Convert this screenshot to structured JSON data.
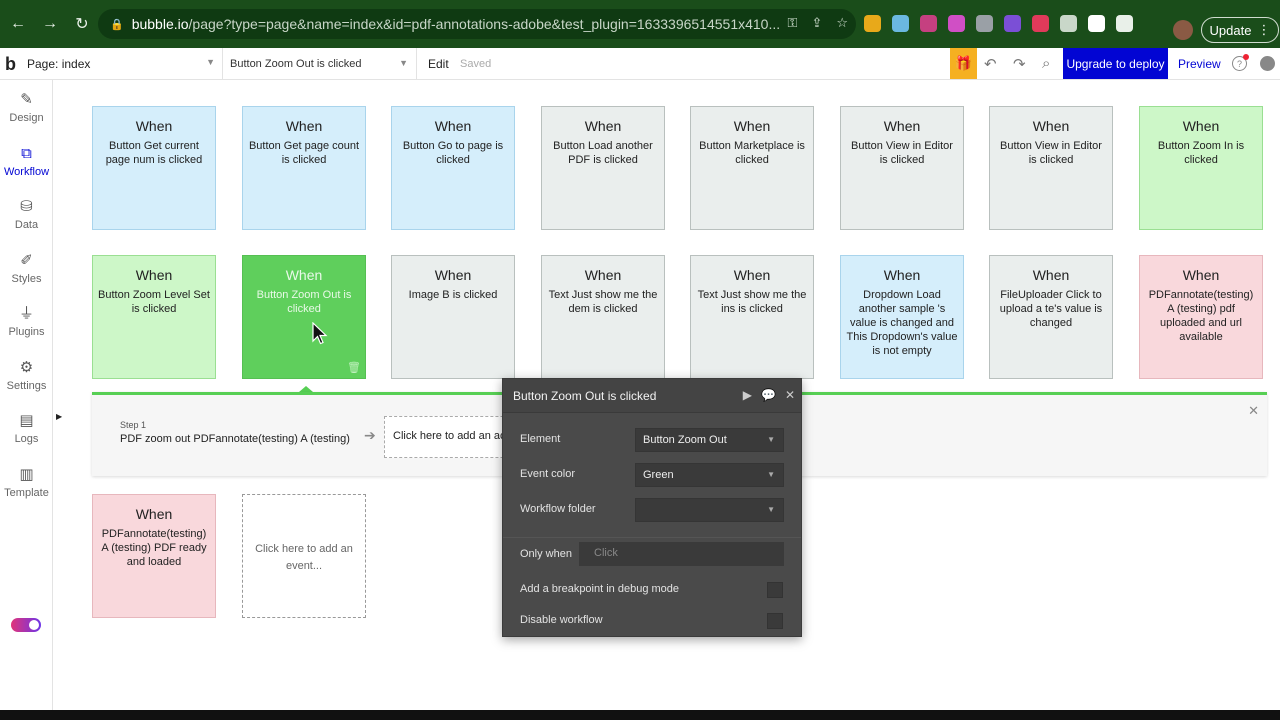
{
  "browser": {
    "url_host": "bubble.io",
    "url_path": "/page?type=page&name=index&id=pdf-annotations-adobe&test_plugin=1633396514551x410...",
    "update_label": "Update",
    "nav": [
      "back-icon",
      "forward-icon",
      "reload-icon"
    ]
  },
  "topbar": {
    "page_label": "Page: index",
    "event_label": "Button Zoom Out is clicked",
    "edit_label": "Edit",
    "saved_label": "Saved",
    "upgrade_label": "Upgrade to deploy",
    "preview_label": "Preview"
  },
  "sidebar": {
    "items": [
      {
        "label": "Design",
        "icon": "design-icon"
      },
      {
        "label": "Workflow",
        "icon": "workflow-icon"
      },
      {
        "label": "Data",
        "icon": "data-icon"
      },
      {
        "label": "Styles",
        "icon": "styles-icon"
      },
      {
        "label": "Plugins",
        "icon": "plugins-icon"
      },
      {
        "label": "Settings",
        "icon": "settings-icon"
      },
      {
        "label": "Logs",
        "icon": "logs-icon"
      },
      {
        "label": "Template",
        "icon": "template-icon"
      }
    ],
    "active": "Workflow"
  },
  "workflow": {
    "events": [
      {
        "when": "When",
        "text": "Button Get current page num is clicked",
        "color": "blue"
      },
      {
        "when": "When",
        "text": "Button Get page count is clicked",
        "color": "blue"
      },
      {
        "when": "When",
        "text": "Button Go to page is clicked",
        "color": "blue"
      },
      {
        "when": "When",
        "text": "Button Load another PDF is clicked",
        "color": "gray"
      },
      {
        "when": "When",
        "text": "Button Marketplace is clicked",
        "color": "gray"
      },
      {
        "when": "When",
        "text": "Button View in Editor is clicked",
        "color": "gray"
      },
      {
        "when": "When",
        "text": "Button View in Editor is clicked",
        "color": "gray"
      },
      {
        "when": "When",
        "text": "Button Zoom In is clicked",
        "color": "green"
      },
      {
        "when": "When",
        "text": "Button Zoom Level Set is clicked",
        "color": "green"
      },
      {
        "when": "When",
        "text": "Button Zoom Out is clicked",
        "color": "selected"
      },
      {
        "when": "When",
        "text": "Image B is clicked",
        "color": "gray"
      },
      {
        "when": "When",
        "text": "Text Just show me the dem is clicked",
        "color": "gray"
      },
      {
        "when": "When",
        "text": "Text Just show me the ins is clicked",
        "color": "gray"
      },
      {
        "when": "When",
        "text": "Dropdown Load another sample 's value is changed and This Dropdown's value is not empty",
        "color": "blue"
      },
      {
        "when": "When",
        "text": "FileUploader Click to upload a te's value is changed",
        "color": "gray"
      },
      {
        "when": "When",
        "text": "PDFannotate(testing) A (testing) pdf uploaded and url available",
        "color": "red"
      },
      {
        "when": "When",
        "text": "PDFannotate(testing) A (testing) PDF ready and loaded",
        "color": "red"
      }
    ],
    "add_event_label": "Click here to add an event...",
    "step": {
      "label": "Step 1",
      "text": "PDF zoom out PDFannotate(testing) A (testing)",
      "add_action_label": "Click here to add an action..."
    }
  },
  "popup": {
    "title": "Button Zoom Out is clicked",
    "element_label": "Element",
    "element_value": "Button Zoom Out",
    "color_label": "Event color",
    "color_value": "Green",
    "folder_label": "Workflow folder",
    "folder_value": "",
    "only_when_label": "Only when",
    "only_when_placeholder": "Click",
    "breakpoint_label": "Add a breakpoint in debug mode",
    "disable_label": "Disable workflow"
  },
  "colors": {
    "accent": "#0205d3",
    "selected_event": "#5fcf5c",
    "gift": "#f5b021"
  }
}
